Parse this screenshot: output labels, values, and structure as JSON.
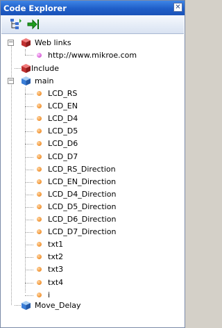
{
  "window": {
    "title": "Code Explorer",
    "close_glyph": "✕"
  },
  "toolbar": {
    "buttons": [
      "tree-view-icon",
      "jump-to-icon"
    ]
  },
  "tree": {
    "web_links": {
      "label": "Web links",
      "children": [
        "http://www.mikroe.com"
      ]
    },
    "include": {
      "label": "Include"
    },
    "main": {
      "label": "main",
      "children": [
        "LCD_RS",
        "LCD_EN",
        "LCD_D4",
        "LCD_D5",
        "LCD_D6",
        "LCD_D7",
        "LCD_RS_Direction",
        "LCD_EN_Direction",
        "LCD_D4_Direction",
        "LCD_D5_Direction",
        "LCD_D6_Direction",
        "LCD_D7_Direction",
        "txt1",
        "txt2",
        "txt3",
        "txt4",
        "i"
      ]
    },
    "move_delay": {
      "label": "Move_Delay"
    }
  },
  "colors": {
    "title_bar": "#2563d0",
    "cube_red": "#c03030",
    "cube_blue": "#3a7ed8",
    "item_dot": "#f0902e",
    "link_dot": "#d45ad4"
  }
}
